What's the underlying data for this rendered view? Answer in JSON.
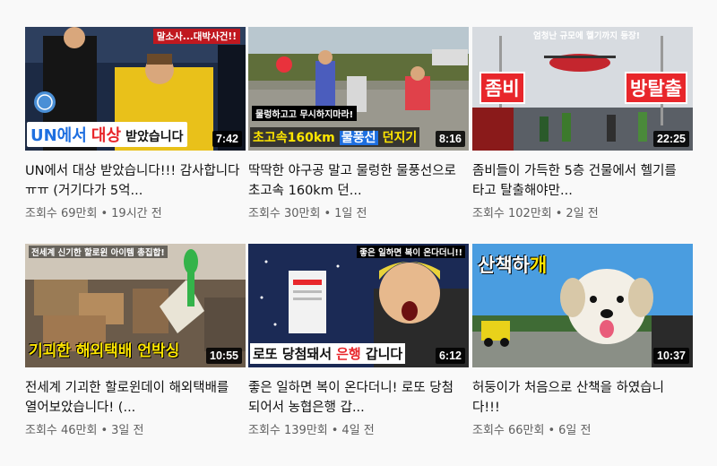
{
  "videos": [
    {
      "title": "UN에서 대상 받았습니다!!! 감사합니다ㅠㅠ (거기다가 5억...",
      "views": "조회수 69만회",
      "age": "19시간 전",
      "duration": "7:42",
      "thumb_top_text": "말소사...대박사건!!",
      "thumb_caption_a": "UN에서",
      "thumb_caption_b": "대상",
      "thumb_caption_c": "받았습니다"
    },
    {
      "title": "딱딱한 야구공 말고 물렁한 물풍선으로 초고속 160km 던...",
      "views": "조회수 30만회",
      "age": "1일 전",
      "duration": "8:16",
      "thumb_top_text": "물렁하고고 무시하지마라!",
      "thumb_caption_a": "초고속160km",
      "thumb_caption_b": "물풍선",
      "thumb_caption_c": "던지기"
    },
    {
      "title": "좀비들이 가득한 5층 건물에서 헬기를 타고 탈출해야만...",
      "views": "조회수 102만회",
      "age": "2일 전",
      "duration": "22:25",
      "thumb_top_text": "엄청난 규모에 헬기까지 등장!",
      "thumb_caption_a": "좀비",
      "thumb_caption_b": "방탈출"
    },
    {
      "title": "전세계 기괴한 할로윈데이 해외택배를 열어보았습니다! (...",
      "views": "조회수 46만회",
      "age": "3일 전",
      "duration": "10:55",
      "thumb_top_text": "전세계 신기한 할로윈 아이템 총집합!",
      "thumb_caption_a": "기괴한 해외택배 언박싱"
    },
    {
      "title": "좋은 일하면 복이 온다더니! 로또 당첨 되어서 농협은행 갑...",
      "views": "조회수 139만회",
      "age": "4일 전",
      "duration": "6:12",
      "thumb_top_text": "좋은 일하면 복이 온다더니!!",
      "thumb_caption_a": "로또 당첨돼서",
      "thumb_caption_b": "은행",
      "thumb_caption_c": "갑니다"
    },
    {
      "title": "허둥이가 처음으로 산책을 하였습니다!!!",
      "views": "조회수 66만회",
      "age": "6일 전",
      "duration": "10:37",
      "thumb_caption_a": "산책하",
      "thumb_caption_b": "개"
    }
  ],
  "separator": "•",
  "colors": {
    "meta_text": "#606060",
    "title_text": "#111111",
    "duration_bg": "#000000",
    "caption_yellow": "#ffe600",
    "caption_red": "#e8262b",
    "caption_blue": "#1e6fe0"
  }
}
